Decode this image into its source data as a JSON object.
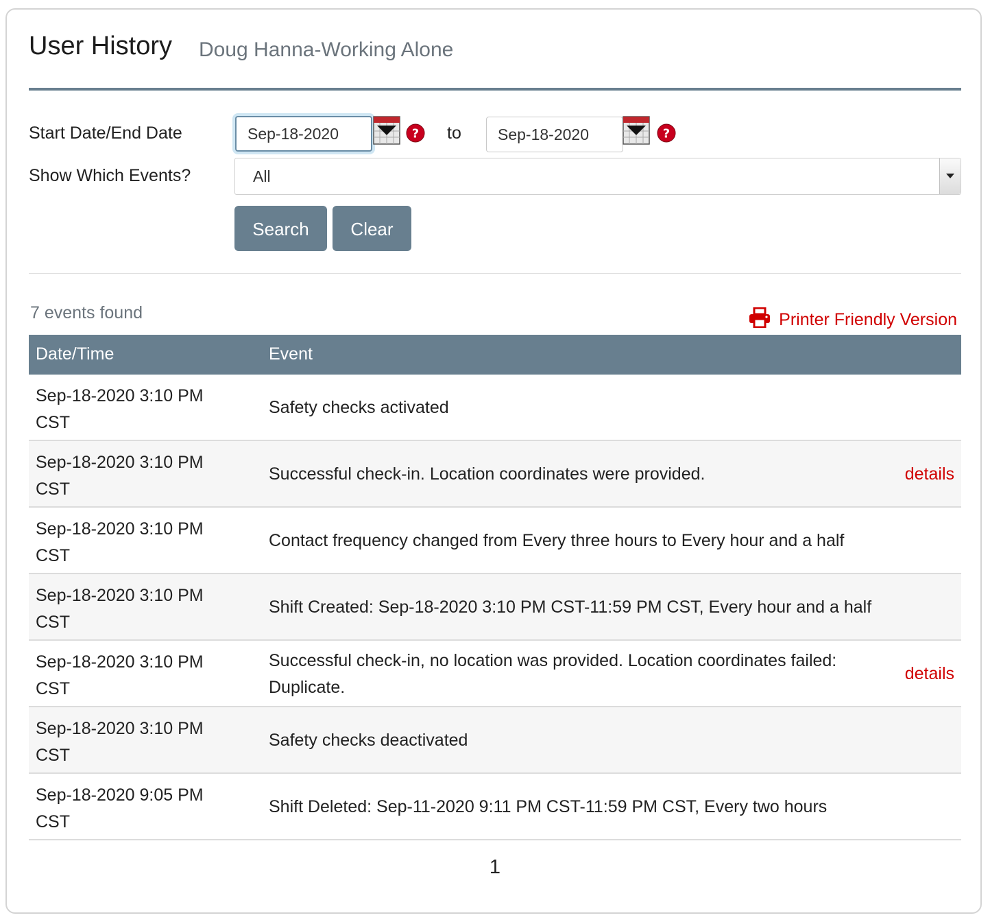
{
  "header": {
    "title": "User History",
    "subtitle": "Doug Hanna-Working Alone"
  },
  "filters": {
    "date_label": "Start Date/End Date",
    "start_date": "Sep-18-2020",
    "to_label": "to",
    "end_date": "Sep-18-2020",
    "events_label": "Show Which Events?",
    "events_selected": "All",
    "search_label": "Search",
    "clear_label": "Clear"
  },
  "results": {
    "count_text": "7 events found",
    "print_label": "Printer Friendly Version",
    "columns": [
      "Date/Time",
      "Event"
    ],
    "details_label": "details",
    "rows": [
      {
        "date": "Sep-18-2020 3:10 PM CST",
        "event": "Safety checks activated",
        "details": ""
      },
      {
        "date": "Sep-18-2020 3:10 PM CST",
        "event": "Successful check-in. Location coordinates were provided.",
        "details": "details"
      },
      {
        "date": "Sep-18-2020 3:10 PM CST",
        "event": "Contact frequency changed from Every three hours to Every hour and a half",
        "details": ""
      },
      {
        "date": "Sep-18-2020 3:10 PM CST",
        "event": "Shift Created: Sep-18-2020 3:10 PM CST-11:59 PM CST, Every hour and a half",
        "details": ""
      },
      {
        "date": "Sep-18-2020 3:10 PM CST",
        "event": "Successful check-in, no location was provided. Location coordinates failed: Duplicate.",
        "details": "details"
      },
      {
        "date": "Sep-18-2020 3:10 PM CST",
        "event": "Safety checks deactivated",
        "details": ""
      },
      {
        "date": "Sep-18-2020 9:05 PM CST",
        "event": "Shift Deleted: Sep-11-2020 9:11 PM CST-11:59 PM CST, Every two hours",
        "details": ""
      }
    ]
  },
  "pagination": {
    "current_page": "1"
  },
  "colors": {
    "accent": "#687f8f",
    "link": "#d00000",
    "muted": "#6b747c"
  },
  "icons": {
    "calendar": "calendar-icon",
    "help": "help-icon",
    "printer": "printer-icon"
  }
}
